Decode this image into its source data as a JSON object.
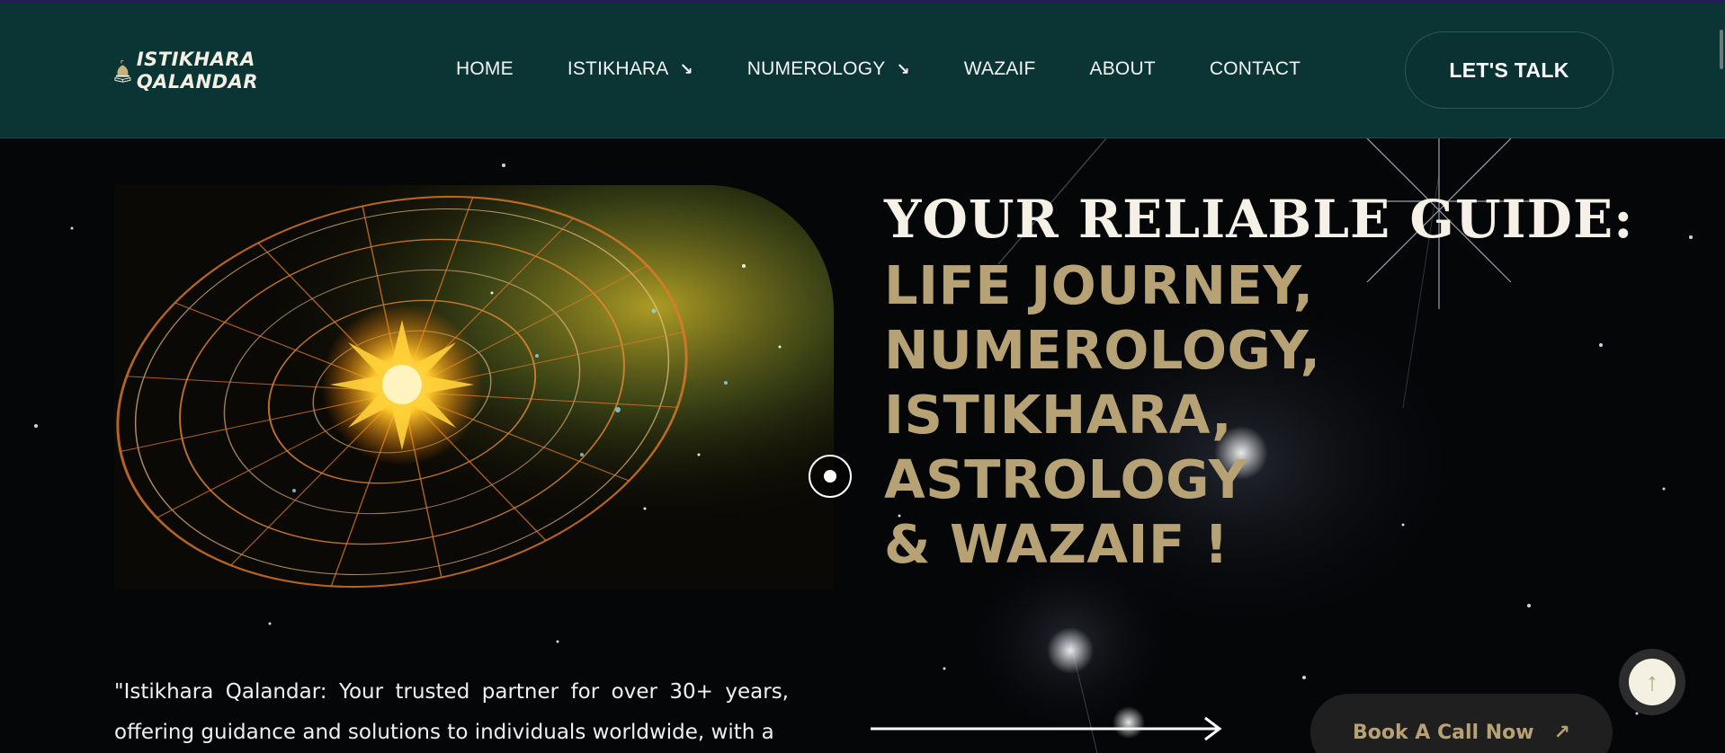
{
  "brand": {
    "name_line1": "ISTIKHARA",
    "name_line2": "QALANDAR"
  },
  "nav": {
    "items": [
      {
        "label": "HOME",
        "has_dropdown": false
      },
      {
        "label": "ISTIKHARA",
        "has_dropdown": true
      },
      {
        "label": "NUMEROLOGY",
        "has_dropdown": true
      },
      {
        "label": "WAZAIF",
        "has_dropdown": false
      },
      {
        "label": "ABOUT",
        "has_dropdown": false
      },
      {
        "label": "CONTACT",
        "has_dropdown": false
      }
    ],
    "dropdown_icon": "arrow-down-right-icon",
    "cta_label": "LET'S TALK"
  },
  "hero": {
    "title_line": "YOUR RELIABLE GUIDE:",
    "subtitle": "LIFE JOURNEY,\nNUMEROLOGY,\nISTIKHARA, ASTROLOGY\n& WAZAIF !",
    "image_icon": "zodiac-wheel-image",
    "intro_text": "\"Istikhara Qalandar: Your trusted partner for over 30+ years, offering guidance and solutions to individuals worldwide, with a",
    "book_label": "Book A Call Now",
    "book_icon": "arrow-up-right-icon",
    "scroll_top_icon": "arrow-up-icon"
  },
  "colors": {
    "header_bg": "#0b3535",
    "gold": "#b6a275",
    "page_bg": "#050608"
  }
}
